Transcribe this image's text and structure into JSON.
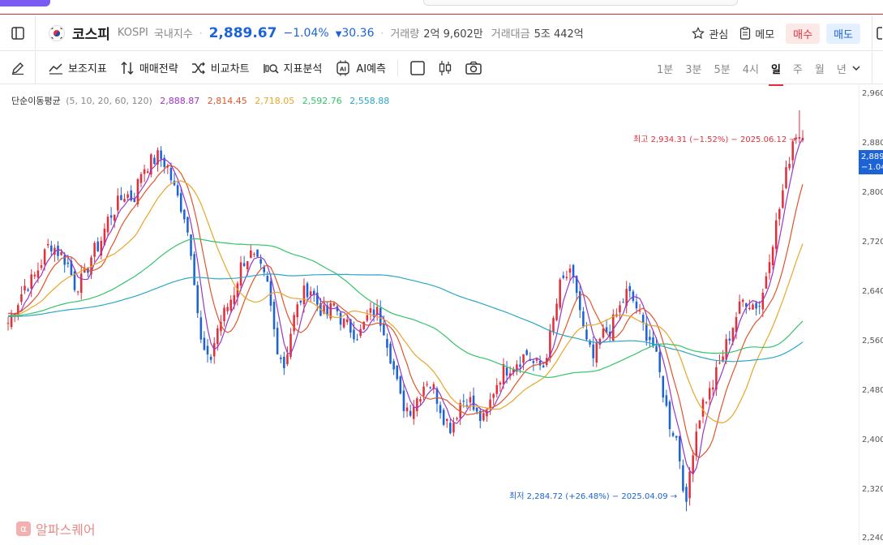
{
  "header": {
    "title": "코스피",
    "code": "KOSPI",
    "market": "국내지수",
    "price": "2,889.67",
    "change_pct": "−1.04%",
    "change_abs": "30.36",
    "volume_label": "거래량",
    "volume_value": "2억 9,602만",
    "amount_label": "거래대금",
    "amount_value": "5조 442억",
    "watch_label": "관심",
    "memo_label": "메모",
    "buy_label": "매수",
    "sell_label": "매도"
  },
  "toolbar": {
    "indicators": "보조지표",
    "strategy": "매매전략",
    "compare": "비교차트",
    "analysis": "지표분석",
    "ai": "AI예측",
    "timeframes": [
      "1분",
      "3분",
      "5분",
      "4시",
      "일",
      "주",
      "월",
      "년"
    ],
    "active_timeframe": "일"
  },
  "legend": {
    "label": "단순이동평균",
    "params": "(5, 10, 20, 60, 120)",
    "values": [
      "2,888.87",
      "2,814.45",
      "2,718.05",
      "2,592.76",
      "2,558.88"
    ],
    "colors": [
      "#9b35c9",
      "#e0552b",
      "#e8a628",
      "#35c46a",
      "#2aa7c9"
    ]
  },
  "price_tag": {
    "line1": "2,889",
    "line2": "−1.04"
  },
  "annotations": {
    "high": "최고 2,934.31 (−1.52%) − 2025.06.12 →",
    "low": "최저 2,284.72 (+26.48%) − 2025.04.09 →"
  },
  "brand": "알파스퀘어",
  "colors": {
    "up": "#e0303b",
    "down": "#1e63d6",
    "accent": "#e0303b"
  },
  "chart_data": {
    "type": "candlestick",
    "yticks": [
      "2,960",
      "2,880",
      "2,800",
      "2,720",
      "2,640",
      "2,560",
      "2,480",
      "2,400",
      "2,320",
      "2,240"
    ],
    "ylim": [
      2230,
      2975
    ],
    "high": {
      "value": 2934.31,
      "date": "2025.06.12"
    },
    "low": {
      "value": 2284.72,
      "date": "2025.04.09"
    },
    "close_path": [
      2590,
      2620,
      2650,
      2660,
      2690,
      2720,
      2705,
      2690,
      2650,
      2660,
      2700,
      2720,
      2760,
      2780,
      2800,
      2790,
      2840,
      2850,
      2860,
      2845,
      2800,
      2770,
      2700,
      2560,
      2520,
      2580,
      2610,
      2640,
      2690,
      2700,
      2680,
      2650,
      2560,
      2520,
      2590,
      2630,
      2650,
      2620,
      2600,
      2620,
      2590,
      2580,
      2570,
      2600,
      2610,
      2580,
      2520,
      2460,
      2450,
      2470,
      2500,
      2480,
      2440,
      2420,
      2460,
      2470,
      2440,
      2430,
      2480,
      2510,
      2520,
      2530,
      2540,
      2520,
      2520,
      2580,
      2650,
      2670,
      2640,
      2560,
      2530,
      2570,
      2580,
      2610,
      2640,
      2620,
      2580,
      2560,
      2500,
      2430,
      2400,
      2300,
      2400,
      2460,
      2480,
      2520,
      2560,
      2600,
      2630,
      2620,
      2620,
      2700,
      2760,
      2830,
      2900,
      2890
    ],
    "ma_final": {
      "ma5": 2888.87,
      "ma10": 2814.45,
      "ma20": 2718.05,
      "ma60": 2592.76,
      "ma120": 2558.88
    }
  }
}
